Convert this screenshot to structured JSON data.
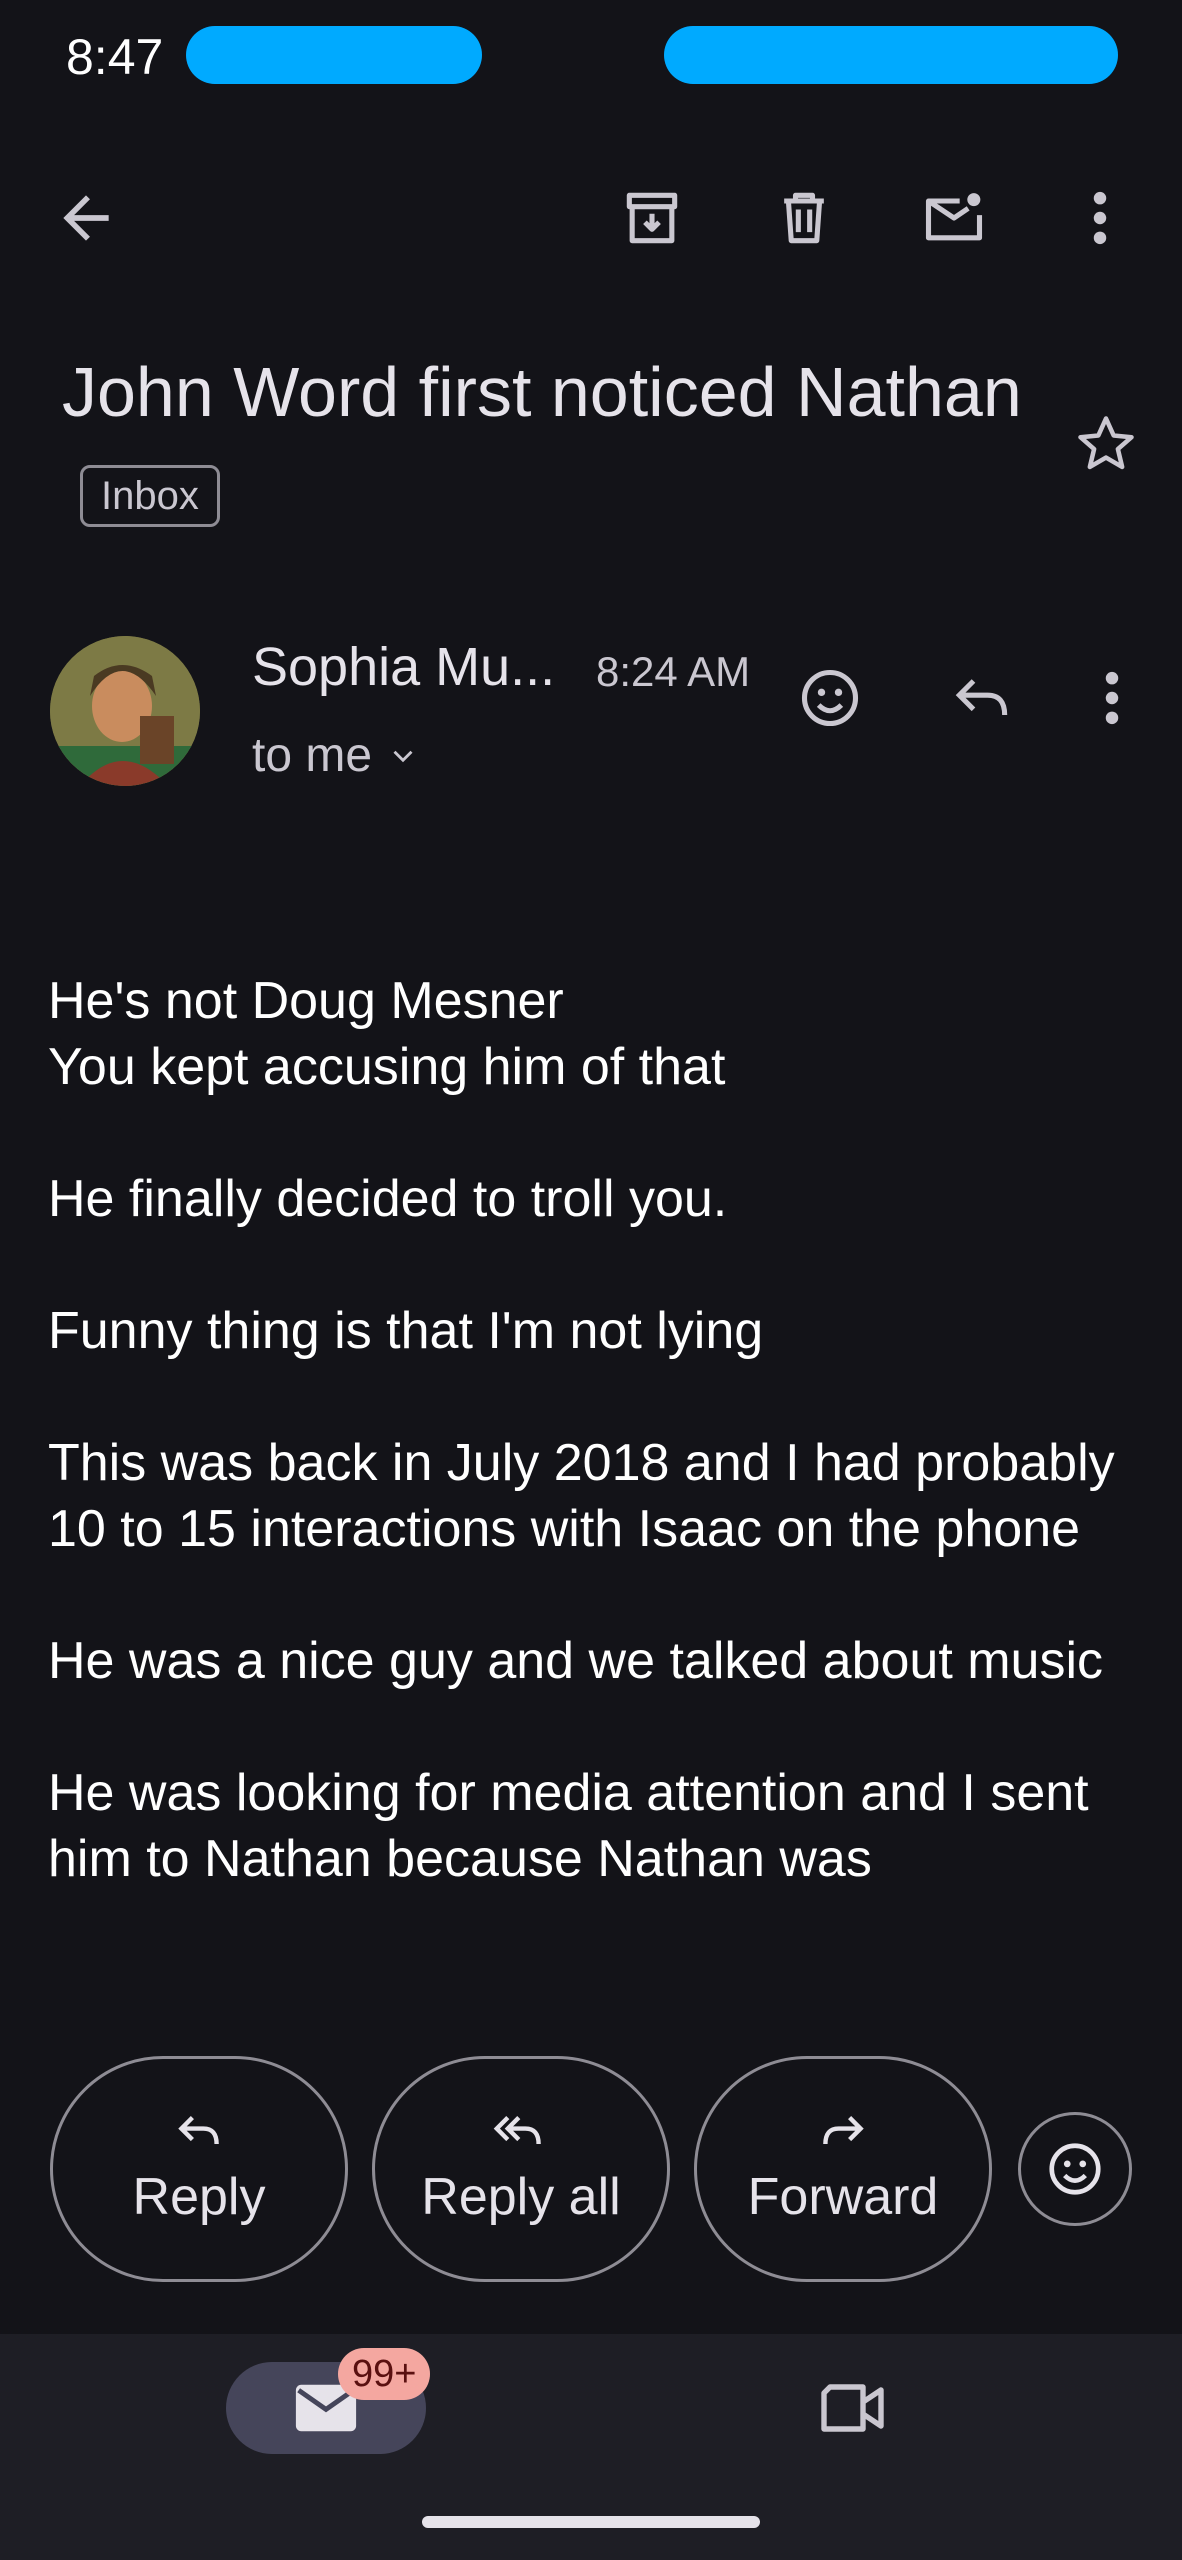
{
  "status_bar": {
    "time": "8:47"
  },
  "toolbar": {
    "back_icon": "arrow-left-icon",
    "archive_icon": "archive-icon",
    "delete_icon": "trash-icon",
    "mark_unread_icon": "mail-unread-icon",
    "more_icon": "more-vert-icon"
  },
  "subject": {
    "title": "John Word first noticed Nathan",
    "label": "Inbox"
  },
  "message": {
    "sender": "Sophia Mu...",
    "time": "8:24 AM",
    "recipient": "to me",
    "body": [
      "He's not Doug Mesner\nYou kept accusing him of that",
      "He finally decided to troll you.",
      "Funny thing is that I'm not lying",
      "This was back in July 2018 and I had probably 10 to 15 interactions with Isaac on the phone",
      "He was a nice guy and we talked about music",
      "He was looking for media attention and I sent him to Nathan because Nathan was"
    ]
  },
  "actions": {
    "reply": "Reply",
    "reply_all": "Reply all",
    "forward": "Forward"
  },
  "nav": {
    "mail_badge": "99+"
  },
  "colors": {
    "background": "#131318",
    "outline": "#8e8c94",
    "badge": "#f4a7a0",
    "redaction": "#00aaff"
  }
}
